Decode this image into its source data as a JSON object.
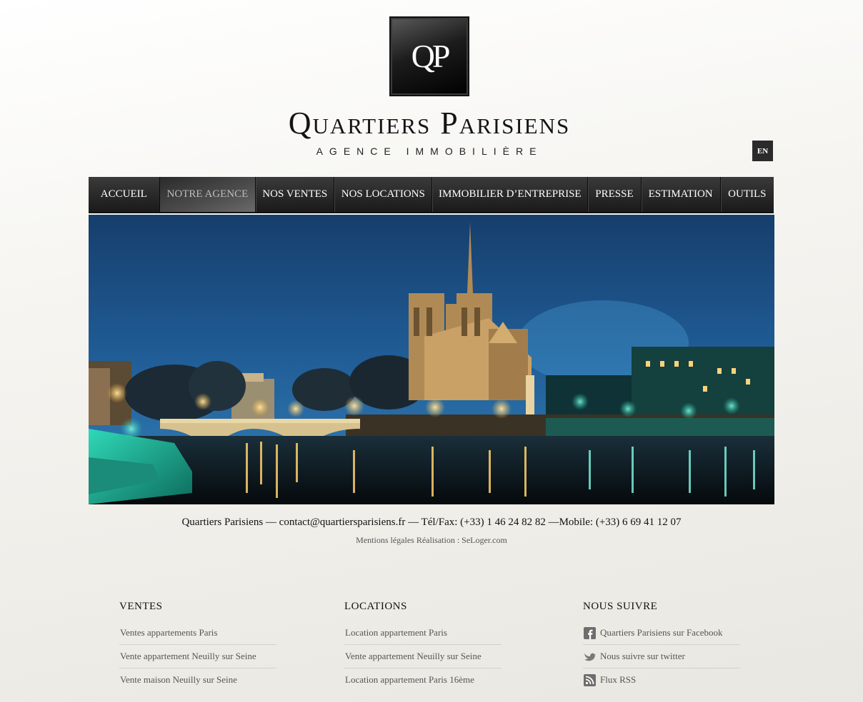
{
  "header": {
    "logo_monogram": "QP",
    "brand_name": "Quartiers Parisiens",
    "brand_subtitle": "AGENCE IMMOBILIÈRE",
    "language_button": "EN"
  },
  "nav": {
    "items": [
      {
        "label": "ACCUEIL",
        "active": false
      },
      {
        "label": "NOTRE AGENCE",
        "active": true
      },
      {
        "label": "NOS VENTES",
        "active": false
      },
      {
        "label": "NOS LOCATIONS",
        "active": false
      },
      {
        "label": "IMMOBILIER D’ENTREPRISE",
        "active": false
      },
      {
        "label": "PRESSE",
        "active": false
      },
      {
        "label": "ESTIMATION",
        "active": false
      },
      {
        "label": "OUTILS",
        "active": false
      }
    ]
  },
  "contact": {
    "line": "Quartiers Parisiens — contact@quartiersparisiens.fr — Tél/Fax: (+33) 1 46 24 82 82 —Mobile: (+33) 6 69 41 12 07"
  },
  "legal": {
    "mentions": "Mentions légales",
    "realisation": "Réalisation : SeLoger.com"
  },
  "footer": {
    "ventes": {
      "title": "VENTES",
      "links": [
        "Ventes appartements Paris",
        "Vente appartement Neuilly sur Seine",
        "Vente maison Neuilly sur Seine"
      ]
    },
    "locations": {
      "title": "LOCATIONS",
      "links": [
        "Location appartement Paris",
        "Vente appartement Neuilly sur Seine",
        "Location appartement Paris 16ème"
      ]
    },
    "social": {
      "title": "NOUS SUIVRE",
      "facebook": "Quartiers Parisiens sur Facebook",
      "twitter": "Nous suivre sur twitter",
      "rss": "Flux RSS"
    }
  },
  "colors": {
    "nav_bg": "#1f1f1f",
    "nav_active_text": "#bdbdbd",
    "sky": "#1d4f86",
    "river_teal": "#1fb79c"
  }
}
